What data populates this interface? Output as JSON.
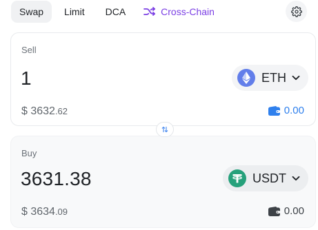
{
  "tabs": [
    {
      "label": "Swap",
      "active": true
    },
    {
      "label": "Limit",
      "active": false
    },
    {
      "label": "DCA",
      "active": false
    },
    {
      "label": "Cross-Chain",
      "active": false,
      "icon": "shuffle-icon"
    }
  ],
  "settings": {
    "icon": "gear-icon"
  },
  "sell": {
    "label": "Sell",
    "amount": "1",
    "token": {
      "symbol": "ETH",
      "icon": "ethereum-icon",
      "color": "#627eea"
    },
    "usd_main": "$ 3632",
    "usd_cents": ".62",
    "balance": "0.00",
    "balance_icon": "wallet-icon",
    "balance_color": "#2f80ed"
  },
  "switch": {
    "icon": "swap-arrows-icon"
  },
  "buy": {
    "label": "Buy",
    "amount": "3631.38",
    "token": {
      "symbol": "USDT",
      "icon": "tether-icon",
      "color": "#26a17b"
    },
    "usd_main": "$ 3634",
    "usd_cents": ".09",
    "balance": "0.00",
    "balance_icon": "wallet-icon"
  },
  "colors": {
    "accent_purple": "#7b3fe4",
    "accent_blue": "#2f80ed"
  }
}
